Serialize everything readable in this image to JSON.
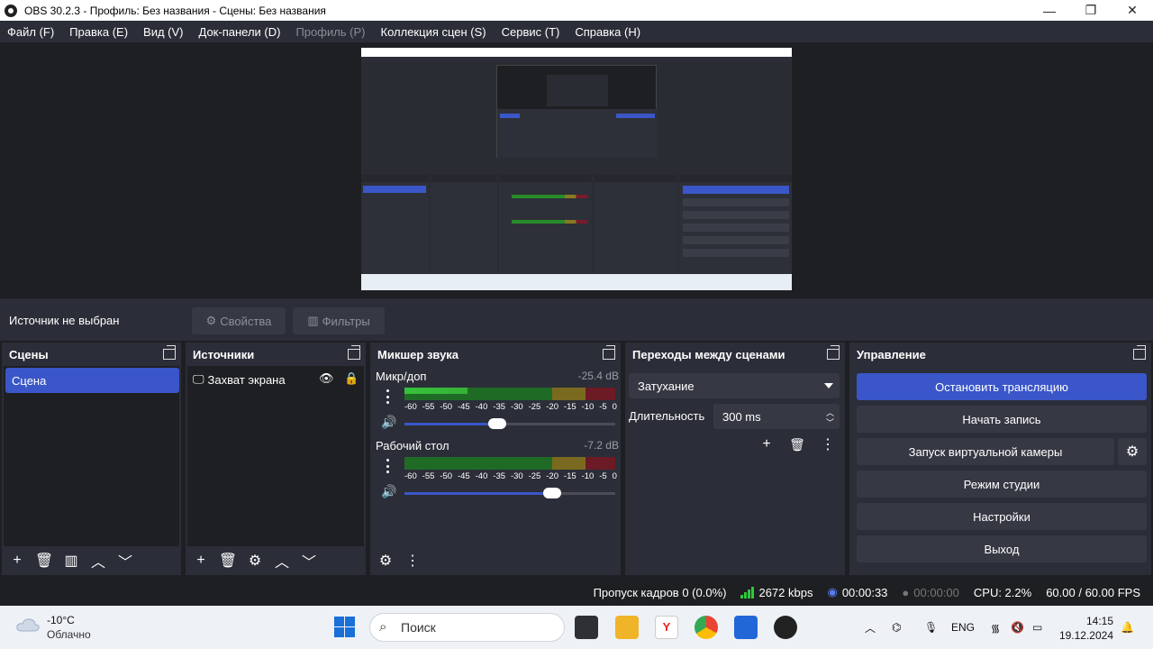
{
  "window": {
    "title": "OBS 30.2.3 - Профиль: Без названия - Сцены: Без названия",
    "minimize": "—",
    "maximize": "❐",
    "close": "✕"
  },
  "menu": [
    {
      "label": "Файл (F)",
      "enabled": true
    },
    {
      "label": "Правка (E)",
      "enabled": true
    },
    {
      "label": "Вид (V)",
      "enabled": true
    },
    {
      "label": "Док-панели (D)",
      "enabled": true
    },
    {
      "label": "Профиль (P)",
      "enabled": false
    },
    {
      "label": "Коллекция сцен (S)",
      "enabled": true
    },
    {
      "label": "Сервис (T)",
      "enabled": true
    },
    {
      "label": "Справка (H)",
      "enabled": true
    }
  ],
  "source_toolbar": {
    "no_source": "Источник не выбран",
    "properties": "Свойства",
    "filters": "Фильтры"
  },
  "scenes": {
    "title": "Сцены",
    "items": [
      {
        "label": "Сцена",
        "selected": true
      }
    ]
  },
  "sources": {
    "title": "Источники",
    "items": [
      {
        "label": "Захват экрана",
        "visible": true,
        "locked": false
      }
    ]
  },
  "mixer": {
    "title": "Микшер звука",
    "ticks": [
      "-60",
      "-55",
      "-50",
      "-45",
      "-40",
      "-35",
      "-30",
      "-25",
      "-20",
      "-15",
      "-10",
      "-5",
      "0"
    ],
    "channels": [
      {
        "name": "Микр/доп",
        "db": "-25.4 dB",
        "level": 0.3,
        "volume": 0.44
      },
      {
        "name": "Рабочий стол",
        "db": "-7.2 dB",
        "level": 0.0,
        "volume": 0.7
      }
    ]
  },
  "transitions": {
    "title": "Переходы между сценами",
    "selected": "Затухание",
    "duration_label": "Длительность",
    "duration_value": "300 ms"
  },
  "controls": {
    "title": "Управление",
    "stop_stream": "Остановить трансляцию",
    "start_record": "Начать запись",
    "virtual_camera": "Запуск виртуальной камеры",
    "studio_mode": "Режим студии",
    "settings": "Настройки",
    "exit": "Выход"
  },
  "status": {
    "dropped_frames": "Пропуск кадров 0 (0.0%)",
    "bitrate": "2672 kbps",
    "stream_time": "00:00:33",
    "record_time": "00:00:00",
    "cpu": "CPU: 2.2%",
    "fps": "60.00 / 60.00 FPS"
  },
  "taskbar": {
    "temperature": "-10°C",
    "weather": "Облачно",
    "search_placeholder": "Поиск",
    "language": "ENG",
    "time": "14:15",
    "date": "19.12.2024"
  },
  "colors": {
    "accent": "#3a56c8",
    "panel": "#2b2e38",
    "background": "#1e1f22"
  }
}
